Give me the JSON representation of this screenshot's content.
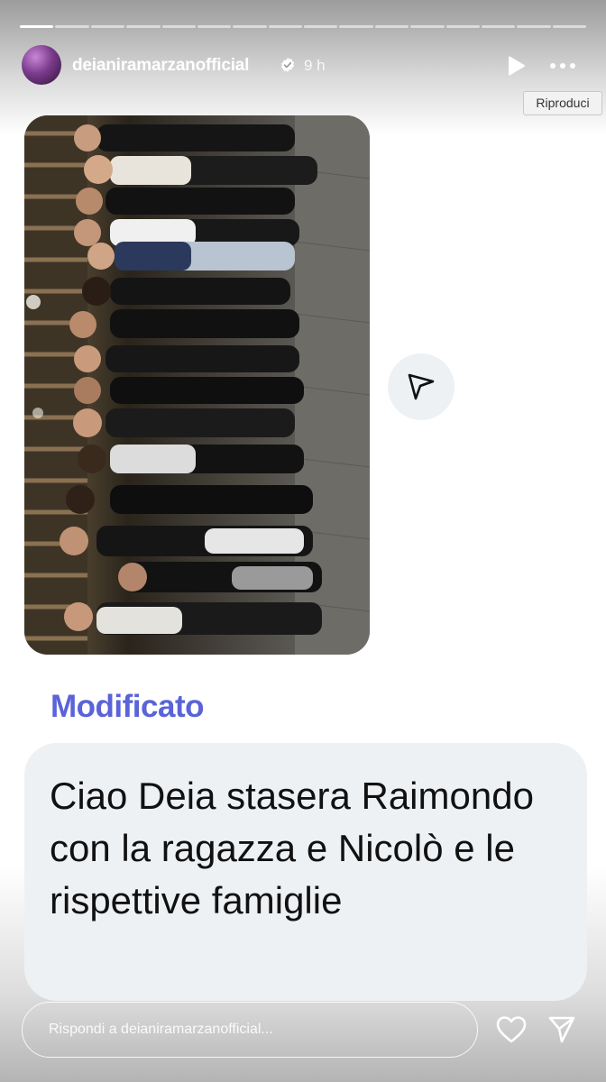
{
  "story": {
    "progress_segments": 16,
    "active_segment": 1
  },
  "header": {
    "username": "deianiramarzanofficial",
    "verified": true,
    "time": "9 h",
    "play_icon": "play-icon",
    "more_icon": "more-horizontal-icon"
  },
  "tooltip": {
    "label": "Riproduci"
  },
  "photo": {
    "description_icon": "group-photo"
  },
  "share": {
    "icon": "send-icon"
  },
  "message": {
    "edited_label": "Modificato",
    "text": "Ciao Deia stasera Raimondo con la ragazza e Nicolò e le rispettive famiglie"
  },
  "footer": {
    "reply_placeholder": "Rispondi a deianiramarzanofficial...",
    "like_icon": "heart-icon",
    "send_icon": "send-icon"
  },
  "colors": {
    "accent": "#5a63d8",
    "bubble": "#eef1f4",
    "share_circle": "#edf1f4"
  }
}
